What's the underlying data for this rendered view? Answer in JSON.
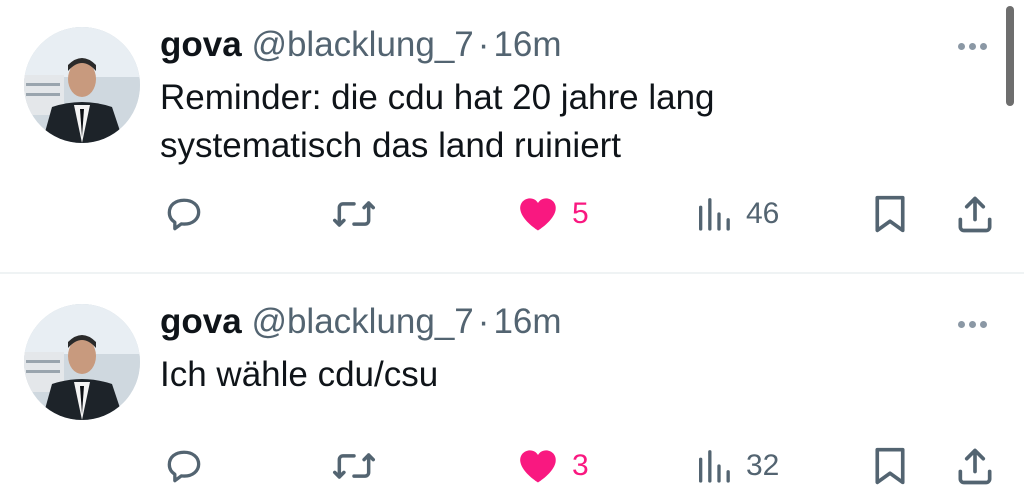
{
  "tweets": [
    {
      "name": "gova",
      "handle": "@blacklung_7",
      "separator": "·",
      "time": "16m",
      "text_lines": [
        "Reminder: die cdu hat 20 jahre lang",
        "systematisch das land ruiniert"
      ],
      "likes": "5",
      "views": "46"
    },
    {
      "name": "gova",
      "handle": "@blacklung_7",
      "separator": "·",
      "time": "16m",
      "text_lines": [
        "Ich wähle cdu/csu"
      ],
      "likes": "3",
      "views": "32"
    }
  ],
  "colors": {
    "text_primary": "#0f1419",
    "text_secondary": "#536471",
    "like_pink": "#f91880",
    "divider": "#eff3f4"
  },
  "icons": [
    "reply-icon",
    "retweet-icon",
    "heart-icon",
    "views-icon",
    "bookmark-icon",
    "share-icon",
    "more-icon"
  ]
}
